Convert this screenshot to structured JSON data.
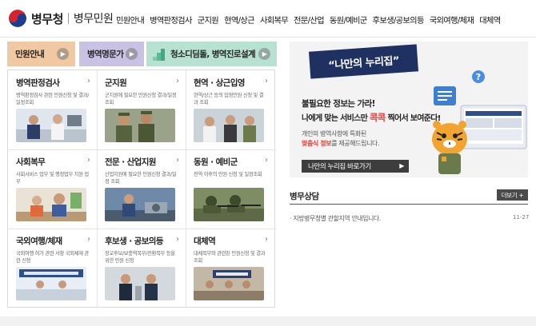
{
  "header": {
    "logo_name": "병무청",
    "logo_sub": "병무민원",
    "nav": [
      "민원안내",
      "병역판정검사",
      "군지원",
      "현역/상근",
      "사회복무",
      "전문/산업",
      "동원/예비군",
      "후보생/공보의등",
      "국외여행/체재",
      "대체역"
    ]
  },
  "tabs": [
    {
      "label": "민원안내",
      "color": "#f0c9a3"
    },
    {
      "label": "병역명문가",
      "color": "#c9c2e3"
    },
    {
      "label": "청소디딤돌, 병역진로설계",
      "color": "#b7e2d2"
    }
  ],
  "services": [
    {
      "title": "병역판정검사",
      "desc": "병역판정검사 관련 민원신청 및 결과/일정조회"
    },
    {
      "title": "군지원",
      "desc": "군지원에 필요한 민원신청 결과/일정 조회"
    },
    {
      "title": "현역 · 상근입영",
      "desc": "현역/상근 등의 입영민원 신청 및 결과 조회"
    },
    {
      "title": "사회복무",
      "desc": "사회서비스 업무 및 행정업무 지원 업무"
    },
    {
      "title": "전문 · 산업지원",
      "desc": "산업지원에 필요한 민원신청 결과/일정 조회"
    },
    {
      "title": "동원 · 예비군",
      "desc": "전역 이후의 민원 신청 및 일정조회"
    },
    {
      "title": "국외여행/체재",
      "desc": "국외여행 허가 관련 사항 국외체재 관련 신청"
    },
    {
      "title": "후보생 · 공보의등",
      "desc": "장교후보/보충역복무/전환복무 등을 위한 민원 신청"
    },
    {
      "title": "대체역",
      "desc": "대체복무와 관련된 민원신청 및 결과 조회"
    }
  ],
  "banner": {
    "title": "“나만의 누리집”",
    "line1": "불필요한 정보는 가라!",
    "line2_a": "나에게 맞는 서비스만",
    "line2_b": "콕콕",
    "line2_c": "찍어서 보여준다!",
    "line3_a": "개인의 병역사항에 특화된",
    "line3_b": "맞춤식 정보",
    "line3_c": "를 제공해드립니다.",
    "button": "나만의 누리집 바로가기",
    "question_mark": "?"
  },
  "consult": {
    "title": "병무상담",
    "more": "더보기 +",
    "items": [
      {
        "text": "· 지방병무청별 관할지역 안내입니다.",
        "date": "11-27"
      }
    ]
  },
  "colors": {
    "brand_red": "#d7242c",
    "brand_blue": "#1a3f8f",
    "highlight": "#e4403a",
    "banner_title_bg": "#1f3160"
  }
}
